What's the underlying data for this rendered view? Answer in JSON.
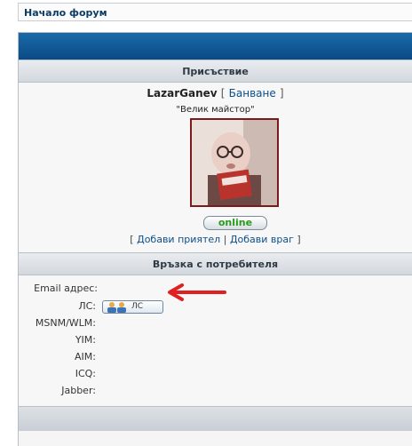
{
  "nav": {
    "forum_home": "Начало форум"
  },
  "sections": {
    "presence": "Присъствие",
    "contact": "Връзка с потребителя"
  },
  "profile": {
    "username": "LazarGanev",
    "bracket_open": "[",
    "ban_link": "Банване",
    "bracket_close": "]",
    "rank": "\"Велик майстор\"",
    "status": "online",
    "add_friend": "Добави приятел",
    "separator": "|",
    "add_enemy": "Добави враг"
  },
  "contact": {
    "fields": [
      {
        "label": "Email адрес:"
      },
      {
        "label": "ЛС:",
        "button_text": "ЛС"
      },
      {
        "label": "MSNM/WLM:"
      },
      {
        "label": "YIM:"
      },
      {
        "label": "AIM:"
      },
      {
        "label": "ICQ:"
      },
      {
        "label": "Jabber:"
      }
    ]
  },
  "colors": {
    "accent_blue": "#0a4a86",
    "arrow": "#e02020",
    "online": "#2a9a1c",
    "avatar_border": "#7a1b1b"
  },
  "icons": {
    "pm": "users-icon",
    "arrow": "arrow-left-icon"
  }
}
